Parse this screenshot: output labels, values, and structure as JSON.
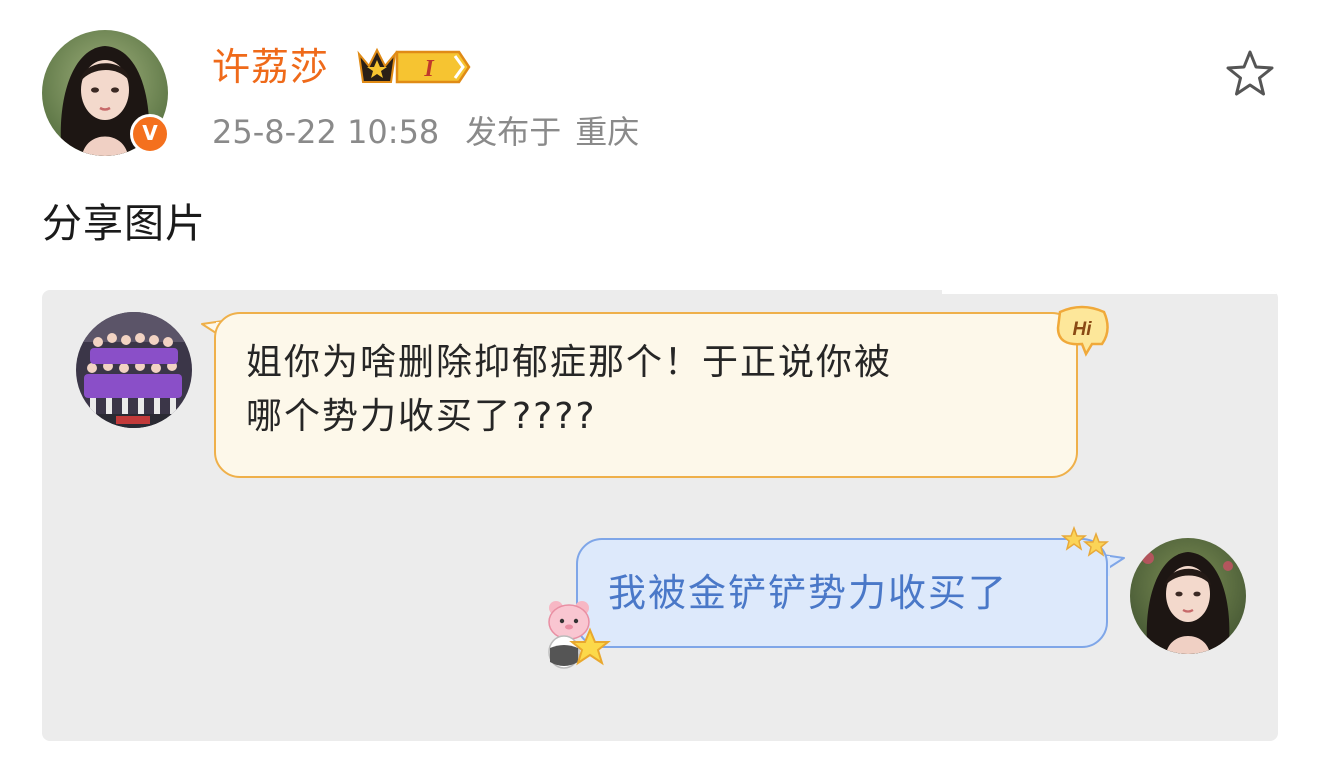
{
  "post": {
    "author": {
      "name": "许荔莎",
      "verified_badge": "V",
      "level_badge": "I",
      "avatar_icon": "woman-portrait-avatar"
    },
    "date": "25-8-22 10:58",
    "published_label": "发布于",
    "location": "重庆",
    "text": "分享图片",
    "favorite_icon": "star-outline-icon"
  },
  "image": {
    "left_message": {
      "line1": "姐你为啥删除抑郁症那个！于正说你被",
      "line2": "哪个势力收买了????",
      "badge_text": "Hi",
      "avatar_icon": "volleyball-team-avatar"
    },
    "right_message": {
      "text": "我被金铲铲势力收买了",
      "avatar_icon": "woman-portrait-avatar"
    }
  },
  "colors": {
    "name_orange": "#ef6a1a",
    "badge_orange": "#f4701e",
    "meta_gray": "#8a8a8a",
    "card_bg": "#ececec",
    "left_bubble_bg": "#fdf8ea",
    "left_bubble_border": "#efb04a",
    "right_bubble_bg": "#dde9fb",
    "right_bubble_border": "#7fa6e8",
    "right_text": "#4a78c8"
  }
}
